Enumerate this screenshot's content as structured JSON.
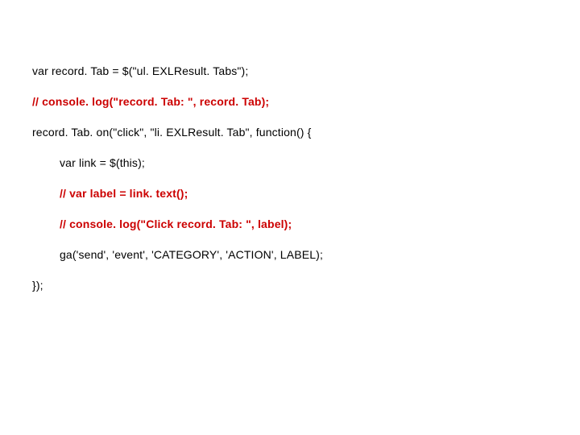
{
  "code": {
    "l1": "var record. Tab = $(\"ul. EXLResult. Tabs\");",
    "l2": "//  console. log(\"record. Tab: \", record. Tab);",
    "l3": "record. Tab. on(\"click\", \"li. EXLResult. Tab\", function() {",
    "l4": "var link = $(this);",
    "l5": "// var label = link. text();",
    "l6": "// console. log(\"Click record. Tab: \", label);",
    "l7": "ga('send', 'event', 'CATEGORY', 'ACTION', LABEL);",
    "l8": "});"
  }
}
